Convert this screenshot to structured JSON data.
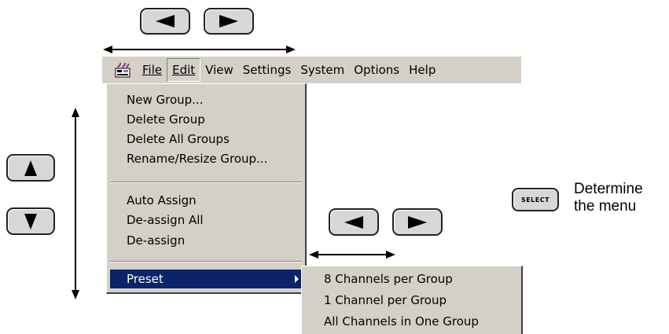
{
  "menubar": {
    "app_icon": "instrument-app-icon",
    "items": [
      {
        "label": "File"
      },
      {
        "label": "Edit"
      },
      {
        "label": "View"
      },
      {
        "label": "Settings"
      },
      {
        "label": "System"
      },
      {
        "label": "Options"
      },
      {
        "label": "Help"
      }
    ],
    "active": "Edit"
  },
  "edit_menu": {
    "items": [
      "New Group...",
      "Delete Group",
      "Delete All Groups",
      "Rename/Resize Group...",
      "Auto Assign",
      "De-assign All",
      "De-assign",
      "Preset"
    ],
    "highlighted": "Preset",
    "highlight_color": "#0a246a"
  },
  "preset_submenu": {
    "items": [
      "8 Channels per Group",
      "1 Channel per Group",
      "All Channels in One Group"
    ]
  },
  "keys": {
    "left": "left-arrow-key",
    "right": "right-arrow-key",
    "up": "up-arrow-key",
    "down": "down-arrow-key",
    "select_label": "SELECT"
  },
  "caption": {
    "line1": "Determine",
    "line2": "the menu"
  }
}
